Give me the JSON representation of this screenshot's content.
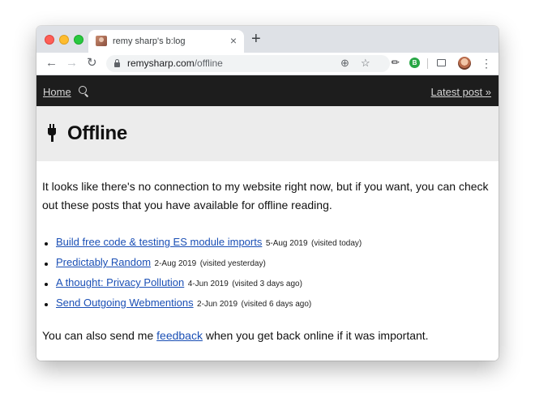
{
  "browser": {
    "tab": {
      "title": "remy sharp's b:log",
      "close": "×"
    },
    "new_tab": "+",
    "nav": {
      "back": "←",
      "forward": "→",
      "reload": "↻"
    },
    "url": {
      "host": "remysharp.com",
      "path": "/offline"
    },
    "omnibox_icons": {
      "add": "⊕",
      "star": "☆"
    },
    "extensions": {
      "pin": "✎",
      "b": "B"
    },
    "menu": "⋮"
  },
  "site_nav": {
    "home": "Home",
    "latest": "Latest post »"
  },
  "hero": {
    "title": "Offline"
  },
  "intro": "It looks like there's no connection to my website right now, but if you want, you can check out these posts that you have available for offline reading.",
  "posts": [
    {
      "title": "Build free code & testing ES module imports",
      "date": "5-Aug 2019",
      "visited": "(visited today)"
    },
    {
      "title": "Predictably Random",
      "date": "2-Aug 2019",
      "visited": "(visited yesterday)"
    },
    {
      "title": "A thought: Privacy Pollution",
      "date": "4-Jun 2019",
      "visited": "(visited 3 days ago)"
    },
    {
      "title": "Send Outgoing Webmentions",
      "date": "2-Jun 2019",
      "visited": "(visited 6 days ago)"
    }
  ],
  "outro": {
    "before": "You can also send me ",
    "link": "feedback",
    "after": " when you get back online if it was important."
  }
}
